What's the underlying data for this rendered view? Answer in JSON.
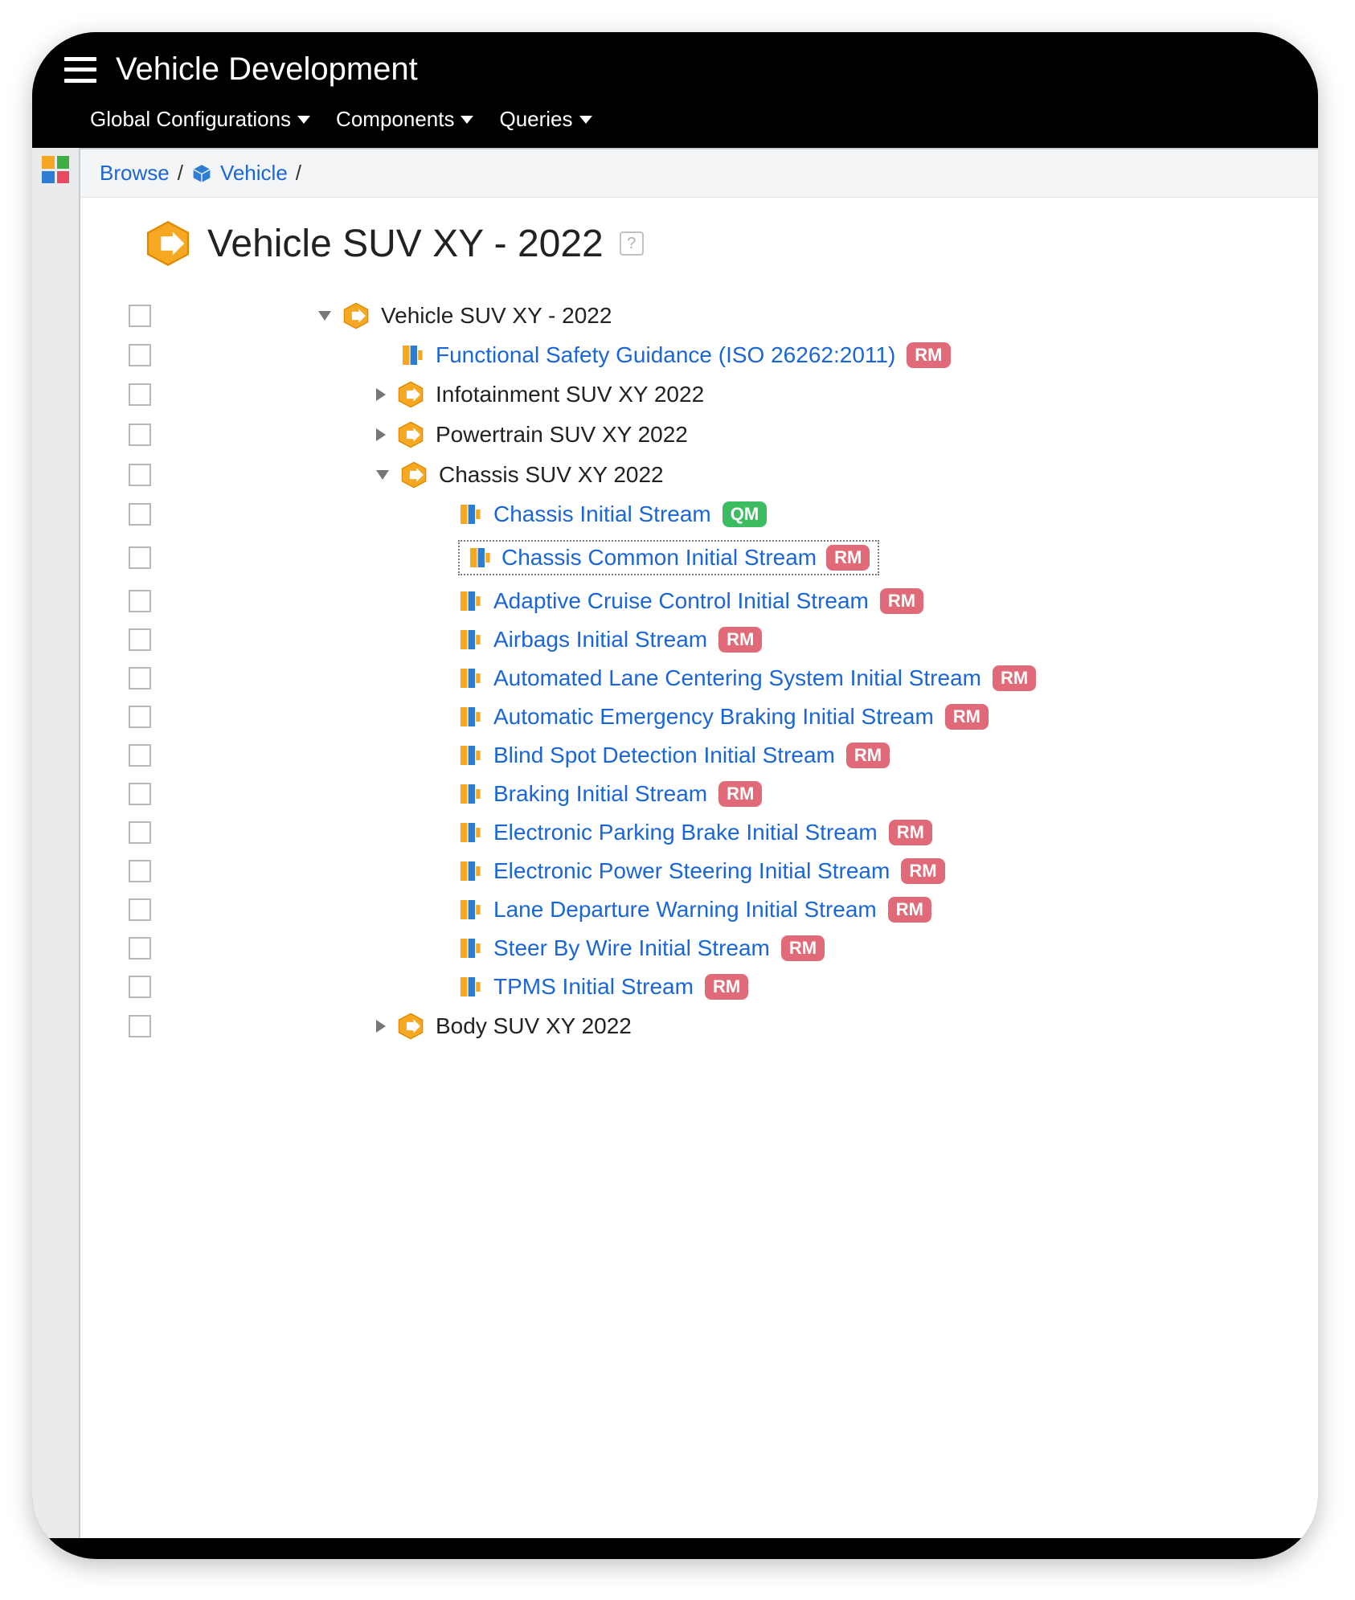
{
  "header": {
    "title": "Vehicle Development"
  },
  "menubar": {
    "items": [
      {
        "label": "Global Configurations"
      },
      {
        "label": "Components"
      },
      {
        "label": "Queries"
      }
    ]
  },
  "breadcrumb": {
    "browse": "Browse",
    "vehicle": "Vehicle"
  },
  "page": {
    "title": "Vehicle SUV XY - 2022",
    "help": "?"
  },
  "tree": [
    {
      "depth": 0,
      "twisty": "down",
      "icon": "hex",
      "label": "Vehicle SUV XY - 2022",
      "link": false,
      "badge": null,
      "selected": false
    },
    {
      "depth": 1,
      "twisty": "none",
      "icon": "stream",
      "label": "Functional Safety Guidance (ISO 26262:2011)",
      "link": true,
      "badge": "RM",
      "selected": false
    },
    {
      "depth": 1,
      "twisty": "right",
      "icon": "hex",
      "label": "Infotainment SUV XY 2022",
      "link": false,
      "badge": null,
      "selected": false
    },
    {
      "depth": 1,
      "twisty": "right",
      "icon": "hex",
      "label": "Powertrain SUV XY 2022",
      "link": false,
      "badge": null,
      "selected": false
    },
    {
      "depth": 1,
      "twisty": "down",
      "icon": "hex",
      "label": "Chassis SUV XY 2022",
      "link": false,
      "badge": null,
      "selected": false
    },
    {
      "depth": 2,
      "twisty": "none",
      "icon": "stream",
      "label": "Chassis Initial Stream",
      "link": true,
      "badge": "QM",
      "selected": false
    },
    {
      "depth": 2,
      "twisty": "none",
      "icon": "stream",
      "label": "Chassis Common Initial Stream",
      "link": true,
      "badge": "RM",
      "selected": true
    },
    {
      "depth": 2,
      "twisty": "none",
      "icon": "stream",
      "label": "Adaptive Cruise Control Initial Stream",
      "link": true,
      "badge": "RM",
      "selected": false
    },
    {
      "depth": 2,
      "twisty": "none",
      "icon": "stream",
      "label": "Airbags Initial Stream",
      "link": true,
      "badge": "RM",
      "selected": false
    },
    {
      "depth": 2,
      "twisty": "none",
      "icon": "stream",
      "label": "Automated Lane Centering System Initial Stream",
      "link": true,
      "badge": "RM",
      "selected": false
    },
    {
      "depth": 2,
      "twisty": "none",
      "icon": "stream",
      "label": "Automatic Emergency Braking Initial Stream",
      "link": true,
      "badge": "RM",
      "selected": false
    },
    {
      "depth": 2,
      "twisty": "none",
      "icon": "stream",
      "label": "Blind Spot Detection Initial Stream",
      "link": true,
      "badge": "RM",
      "selected": false
    },
    {
      "depth": 2,
      "twisty": "none",
      "icon": "stream",
      "label": "Braking Initial Stream",
      "link": true,
      "badge": "RM",
      "selected": false
    },
    {
      "depth": 2,
      "twisty": "none",
      "icon": "stream",
      "label": "Electronic Parking Brake Initial Stream",
      "link": true,
      "badge": "RM",
      "selected": false
    },
    {
      "depth": 2,
      "twisty": "none",
      "icon": "stream",
      "label": "Electronic Power Steering Initial Stream",
      "link": true,
      "badge": "RM",
      "selected": false
    },
    {
      "depth": 2,
      "twisty": "none",
      "icon": "stream",
      "label": "Lane Departure Warning Initial Stream",
      "link": true,
      "badge": "RM",
      "selected": false
    },
    {
      "depth": 2,
      "twisty": "none",
      "icon": "stream",
      "label": "Steer By Wire Initial Stream",
      "link": true,
      "badge": "RM",
      "selected": false
    },
    {
      "depth": 2,
      "twisty": "none",
      "icon": "stream",
      "label": "TPMS Initial Stream",
      "link": true,
      "badge": "RM",
      "selected": false
    },
    {
      "depth": 1,
      "twisty": "right",
      "icon": "hex",
      "label": "Body SUV XY 2022",
      "link": false,
      "badge": null,
      "selected": false
    }
  ]
}
